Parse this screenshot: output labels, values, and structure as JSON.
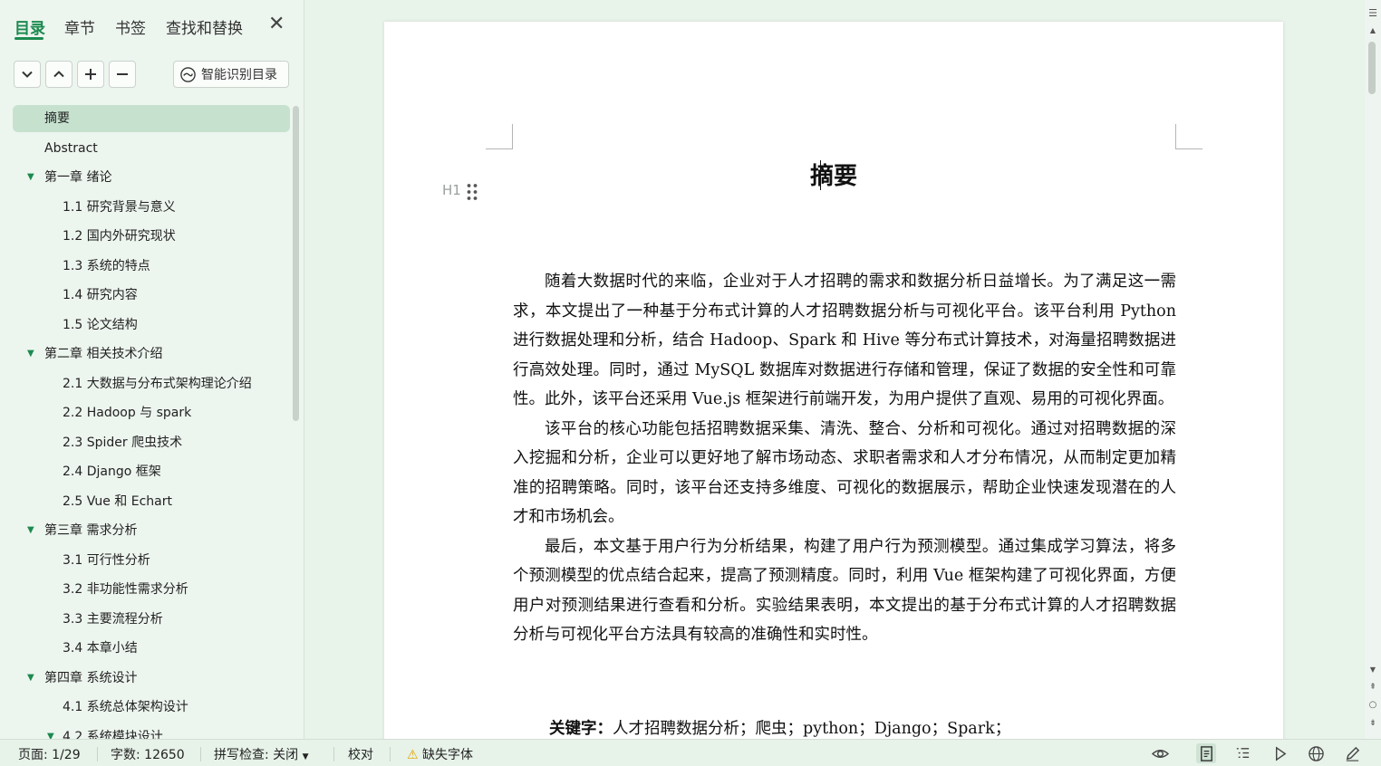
{
  "sidebar": {
    "tabs": [
      {
        "label": "目录",
        "active": true
      },
      {
        "label": "章节"
      },
      {
        "label": "书签"
      },
      {
        "label": "查找和替换"
      }
    ],
    "smart_button_label": "智能识别目录",
    "toc": [
      {
        "label": "摘要",
        "level": 1,
        "selected": true
      },
      {
        "label": "Abstract",
        "level": 1
      },
      {
        "label": "第一章 绪论",
        "level": 1,
        "expanded": true
      },
      {
        "label": "1.1 研究背景与意义",
        "level": 2
      },
      {
        "label": "1.2 国内外研究现状",
        "level": 2
      },
      {
        "label": "1.3 系统的特点",
        "level": 2
      },
      {
        "label": "1.4 研究内容",
        "level": 2
      },
      {
        "label": "1.5 论文结构",
        "level": 2
      },
      {
        "label": "第二章 相关技术介绍",
        "level": 1,
        "expanded": true
      },
      {
        "label": "2.1 大数据与分布式架构理论介绍",
        "level": 2
      },
      {
        "label": "2.2 Hadoop 与 spark",
        "level": 2
      },
      {
        "label": "2.3 Spider 爬虫技术",
        "level": 2
      },
      {
        "label": "2.4 Django 框架",
        "level": 2
      },
      {
        "label": "2.5 Vue 和 Echart",
        "level": 2
      },
      {
        "label": "第三章 需求分析",
        "level": 1,
        "expanded": true
      },
      {
        "label": "3.1 可行性分析",
        "level": 2
      },
      {
        "label": "3.2 非功能性需求分析",
        "level": 2
      },
      {
        "label": "3.3 主要流程分析",
        "level": 2
      },
      {
        "label": "3.4 本章小结",
        "level": 2
      },
      {
        "label": "第四章 系统设计",
        "level": 1,
        "expanded": true
      },
      {
        "label": "4.1 系统总体架构设计",
        "level": 2
      },
      {
        "label": "4.2 系统模块设计",
        "level": 2,
        "expanded": true
      }
    ]
  },
  "document": {
    "heading_marker": "H1",
    "title": "摘要",
    "paragraphs": [
      "随着大数据时代的来临，企业对于人才招聘的需求和数据分析日益增长。为了满足这一需求，本文提出了一种基于分布式计算的人才招聘数据分析与可视化平台。该平台利用 Python 进行数据处理和分析，结合 Hadoop、Spark 和 Hive 等分布式计算技术，对海量招聘数据进行高效处理。同时，通过 MySQL 数据库对数据进行存储和管理，保证了数据的安全性和可靠性。此外，该平台还采用 Vue.js 框架进行前端开发，为用户提供了直观、易用的可视化界面。",
      "该平台的核心功能包括招聘数据采集、清洗、整合、分析和可视化。通过对招聘数据的深入挖掘和分析，企业可以更好地了解市场动态、求职者需求和人才分布情况，从而制定更加精准的招聘策略。同时，该平台还支持多维度、可视化的数据展示，帮助企业快速发现潜在的人才和市场机会。",
      "最后，本文基于用户行为分析结果，构建了用户行为预测模型。通过集成学习算法，将多个预测模型的优点结合起来，提高了预测精度。同时，利用 Vue 框架构建了可视化界面，方便用户对预测结果进行查看和分析。实验结果表明，本文提出的基于分布式计算的人才招聘数据分析与可视化平台方法具有较高的准确性和实时性。"
    ],
    "keywords_label": "关键字：",
    "keywords_text": "人才招聘数据分析；爬虫；python；Django；Spark；"
  },
  "statusbar": {
    "page": "页面: 1/29",
    "word_count": "字数: 12650",
    "spell_check": "拼写检查: 关闭",
    "proofread": "校对",
    "missing_font": "缺失字体"
  },
  "colors": {
    "accent": "#1c8a4f",
    "selected_bg": "#c6e2cf",
    "app_bg": "#e8f3ea"
  }
}
